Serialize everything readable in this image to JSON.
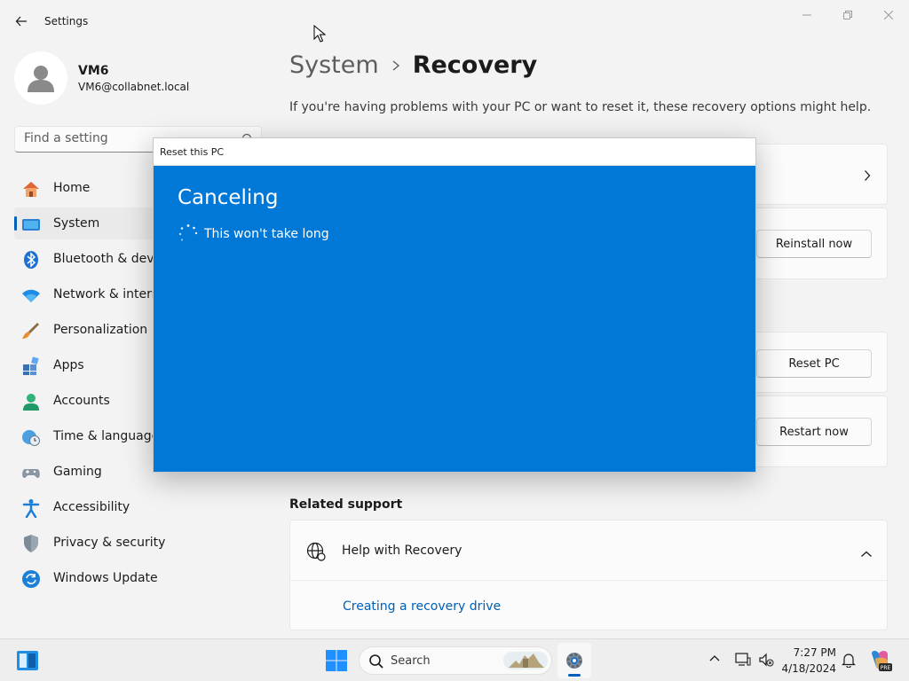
{
  "window": {
    "title": "Settings"
  },
  "profile": {
    "name": "VM6",
    "email": "VM6@collabnet.local"
  },
  "search": {
    "placeholder": "Find a setting"
  },
  "nav": {
    "items": [
      {
        "label": "Home",
        "icon": "home-icon"
      },
      {
        "label": "System",
        "icon": "system-icon",
        "selected": true
      },
      {
        "label": "Bluetooth & devices",
        "icon": "bluetooth-icon"
      },
      {
        "label": "Network & internet",
        "icon": "wifi-icon"
      },
      {
        "label": "Personalization",
        "icon": "brush-icon"
      },
      {
        "label": "Apps",
        "icon": "apps-icon"
      },
      {
        "label": "Accounts",
        "icon": "accounts-icon"
      },
      {
        "label": "Time & language",
        "icon": "clock-globe-icon"
      },
      {
        "label": "Gaming",
        "icon": "gamepad-icon"
      },
      {
        "label": "Accessibility",
        "icon": "accessibility-icon"
      },
      {
        "label": "Privacy & security",
        "icon": "shield-icon"
      },
      {
        "label": "Windows Update",
        "icon": "update-icon"
      }
    ]
  },
  "main": {
    "breadcrumb": {
      "parent": "System",
      "current": "Recovery"
    },
    "description": "If you're having problems with your PC or want to reset it, these recovery options might help.",
    "buttons": {
      "reinstall": "Reinstall now",
      "reset": "Reset PC",
      "restart": "Restart now"
    },
    "related_support": {
      "title": "Related support",
      "help_label": "Help with Recovery",
      "link": "Creating a recovery drive"
    }
  },
  "dialog": {
    "title": "Reset this PC",
    "heading": "Canceling",
    "message": "This won't take long",
    "bg_color": "#0078d7"
  },
  "taskbar": {
    "search_label": "Search",
    "time": "7:27 PM",
    "date": "4/18/2024",
    "copilot_badge": "PRE"
  },
  "colors": {
    "accent": "#005fb8",
    "link": "#005fb8"
  }
}
